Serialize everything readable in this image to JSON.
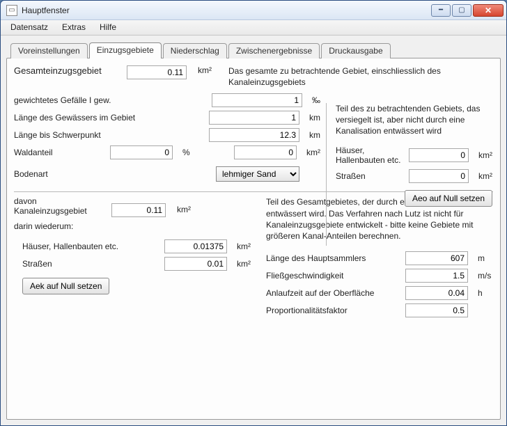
{
  "window": {
    "title": "Hauptfenster"
  },
  "menu": {
    "datensatz": "Datensatz",
    "extras": "Extras",
    "hilfe": "Hilfe"
  },
  "tabs": {
    "voreinstellungen": "Voreinstellungen",
    "einzugsgebiete": "Einzugsgebiete",
    "niederschlag": "Niederschlag",
    "zwischenergebnisse": "Zwischenergebnisse",
    "druckausgabe": "Druckausgabe"
  },
  "gesamt": {
    "label": "Gesamteinzugsgebiet",
    "value": "0.11",
    "unit": "km²",
    "desc": "Das gesamte zu betrachtende Gebiet, einschliesslich des Kanaleinzugsgebiets"
  },
  "left": {
    "gefaelle_label": "gewichtetes Gefälle I gew.",
    "gefaelle_value": "1",
    "gefaelle_unit": "‰",
    "laenge_gewaesser_label": "Länge des Gewässers im Gebiet",
    "laenge_gewaesser_value": "1",
    "laenge_gewaesser_unit": "km",
    "laenge_schwerpunkt_label": "Länge bis Schwerpunkt",
    "laenge_schwerpunkt_value": "12.3",
    "laenge_schwerpunkt_unit": "km",
    "waldanteil_label": "Waldanteil",
    "waldanteil_pct_value": "0",
    "waldanteil_pct_unit": "%",
    "waldanteil_km_value": "0",
    "waldanteil_km_unit": "km²",
    "bodenart_label": "Bodenart",
    "bodenart_value": "lehmiger Sand"
  },
  "right": {
    "desc": "Teil des zu betrachtenden Gebiets, das versiegelt ist, aber nicht durch eine Kanalisation entwässert wird",
    "haeuser_label": "Häuser, Hallenbauten etc.",
    "haeuser_value": "0",
    "unit": "km²",
    "strassen_label": "Straßen",
    "strassen_value": "0",
    "aeo_btn": "Aeo auf Null setzen"
  },
  "kanal": {
    "label1": "davon",
    "label2": "Kanaleinzugsgebiet",
    "value": "0.11",
    "unit": "km²",
    "desc": "Teil des Gesamtgebietes, der durch eine Kanalisation entwässert wird. Das Verfahren nach Lutz ist nicht für Kanaleinzugsgebiete entwickelt - bitte keine Gebiete mit größeren Kanal-Anteilen berechnen.",
    "darin": "darin wiederum:",
    "haeuser_label": "Häuser, Hallenbauten etc.",
    "haeuser_value": "0.01375",
    "strassen_label": "Straßen",
    "strassen_value": "0.01",
    "aek_btn": "Aek auf Null setzen",
    "hs_label": "Länge des Hauptsammlers",
    "hs_value": "607",
    "hs_unit": "m",
    "fg_label": "Fließgeschwindigkeit",
    "fg_value": "1.5",
    "fg_unit": "m/s",
    "al_label": "Anlaufzeit auf der Oberfläche",
    "al_value": "0.04",
    "al_unit": "h",
    "pf_label": "Proportionalitätsfaktor",
    "pf_value": "0.5"
  }
}
